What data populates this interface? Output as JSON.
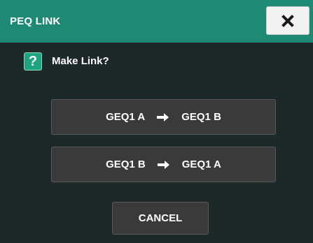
{
  "dialog": {
    "title": "PEQ LINK",
    "close_icon": "close-icon",
    "prompt_icon": "question-icon",
    "prompt_icon_glyph": "?",
    "prompt": "Make Link?",
    "options": [
      {
        "from": "GEQ1 A",
        "to": "GEQ1 B"
      },
      {
        "from": "GEQ1 B",
        "to": "GEQ1 A"
      }
    ],
    "cancel_label": "CANCEL",
    "colors": {
      "titlebar": "#1f8a73",
      "background": "#1d2929",
      "button": "#3a3a3a",
      "accent": "#1fa381"
    }
  }
}
